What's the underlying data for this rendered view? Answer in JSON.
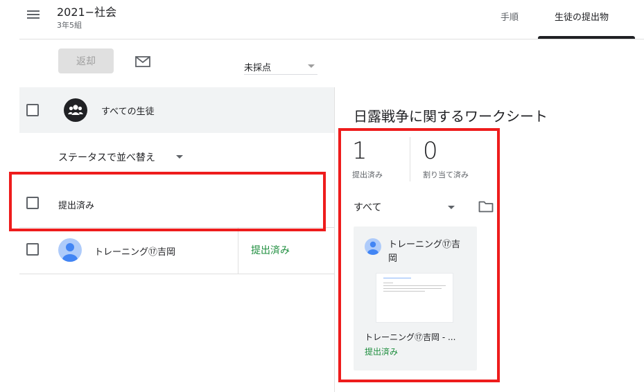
{
  "header": {
    "class_title": "2021−社会",
    "class_subtitle": "3年5組",
    "tabs": [
      {
        "label": "手順",
        "active": false
      },
      {
        "label": "生徒の提出物",
        "active": true
      }
    ]
  },
  "toolbar": {
    "return_label": "返却",
    "grade_filter_value": "未採点"
  },
  "student_list": {
    "all_students_label": "すべての生徒",
    "sort_label": "ステータスで並べ替え",
    "section_label": "提出済み",
    "students": [
      {
        "name": "トレーニング⑰吉岡",
        "status": "提出済み"
      }
    ]
  },
  "assignment_panel": {
    "title": "日露戦争に関するワークシート",
    "turned_in_count": "1",
    "turned_in_label": "提出済み",
    "assigned_count": "0",
    "assigned_label": "割り当て済み",
    "filter_value": "すべて",
    "card": {
      "student_name": "トレーニング⑰吉岡",
      "file_name": "トレーニング⑰吉岡 - ...",
      "status": "提出済み"
    }
  },
  "colors": {
    "highlight": "#ee1c1c",
    "status_green": "#1e8e3e",
    "row_background": "#f1f3f4"
  }
}
